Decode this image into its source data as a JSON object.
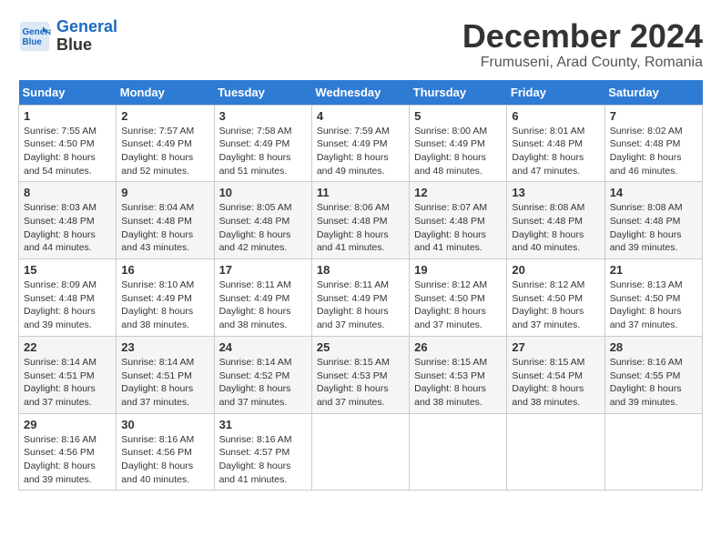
{
  "logo": {
    "line1": "General",
    "line2": "Blue"
  },
  "title": "December 2024",
  "location": "Frumuseni, Arad County, Romania",
  "days_header": [
    "Sunday",
    "Monday",
    "Tuesday",
    "Wednesday",
    "Thursday",
    "Friday",
    "Saturday"
  ],
  "weeks": [
    [
      {
        "day": "1",
        "sunrise": "7:55 AM",
        "sunset": "4:50 PM",
        "daylight": "8 hours and 54 minutes."
      },
      {
        "day": "2",
        "sunrise": "7:57 AM",
        "sunset": "4:49 PM",
        "daylight": "8 hours and 52 minutes."
      },
      {
        "day": "3",
        "sunrise": "7:58 AM",
        "sunset": "4:49 PM",
        "daylight": "8 hours and 51 minutes."
      },
      {
        "day": "4",
        "sunrise": "7:59 AM",
        "sunset": "4:49 PM",
        "daylight": "8 hours and 49 minutes."
      },
      {
        "day": "5",
        "sunrise": "8:00 AM",
        "sunset": "4:49 PM",
        "daylight": "8 hours and 48 minutes."
      },
      {
        "day": "6",
        "sunrise": "8:01 AM",
        "sunset": "4:48 PM",
        "daylight": "8 hours and 47 minutes."
      },
      {
        "day": "7",
        "sunrise": "8:02 AM",
        "sunset": "4:48 PM",
        "daylight": "8 hours and 46 minutes."
      }
    ],
    [
      {
        "day": "8",
        "sunrise": "8:03 AM",
        "sunset": "4:48 PM",
        "daylight": "8 hours and 44 minutes."
      },
      {
        "day": "9",
        "sunrise": "8:04 AM",
        "sunset": "4:48 PM",
        "daylight": "8 hours and 43 minutes."
      },
      {
        "day": "10",
        "sunrise": "8:05 AM",
        "sunset": "4:48 PM",
        "daylight": "8 hours and 42 minutes."
      },
      {
        "day": "11",
        "sunrise": "8:06 AM",
        "sunset": "4:48 PM",
        "daylight": "8 hours and 41 minutes."
      },
      {
        "day": "12",
        "sunrise": "8:07 AM",
        "sunset": "4:48 PM",
        "daylight": "8 hours and 41 minutes."
      },
      {
        "day": "13",
        "sunrise": "8:08 AM",
        "sunset": "4:48 PM",
        "daylight": "8 hours and 40 minutes."
      },
      {
        "day": "14",
        "sunrise": "8:08 AM",
        "sunset": "4:48 PM",
        "daylight": "8 hours and 39 minutes."
      }
    ],
    [
      {
        "day": "15",
        "sunrise": "8:09 AM",
        "sunset": "4:48 PM",
        "daylight": "8 hours and 39 minutes."
      },
      {
        "day": "16",
        "sunrise": "8:10 AM",
        "sunset": "4:49 PM",
        "daylight": "8 hours and 38 minutes."
      },
      {
        "day": "17",
        "sunrise": "8:11 AM",
        "sunset": "4:49 PM",
        "daylight": "8 hours and 38 minutes."
      },
      {
        "day": "18",
        "sunrise": "8:11 AM",
        "sunset": "4:49 PM",
        "daylight": "8 hours and 37 minutes."
      },
      {
        "day": "19",
        "sunrise": "8:12 AM",
        "sunset": "4:50 PM",
        "daylight": "8 hours and 37 minutes."
      },
      {
        "day": "20",
        "sunrise": "8:12 AM",
        "sunset": "4:50 PM",
        "daylight": "8 hours and 37 minutes."
      },
      {
        "day": "21",
        "sunrise": "8:13 AM",
        "sunset": "4:50 PM",
        "daylight": "8 hours and 37 minutes."
      }
    ],
    [
      {
        "day": "22",
        "sunrise": "8:14 AM",
        "sunset": "4:51 PM",
        "daylight": "8 hours and 37 minutes."
      },
      {
        "day": "23",
        "sunrise": "8:14 AM",
        "sunset": "4:51 PM",
        "daylight": "8 hours and 37 minutes."
      },
      {
        "day": "24",
        "sunrise": "8:14 AM",
        "sunset": "4:52 PM",
        "daylight": "8 hours and 37 minutes."
      },
      {
        "day": "25",
        "sunrise": "8:15 AM",
        "sunset": "4:53 PM",
        "daylight": "8 hours and 37 minutes."
      },
      {
        "day": "26",
        "sunrise": "8:15 AM",
        "sunset": "4:53 PM",
        "daylight": "8 hours and 38 minutes."
      },
      {
        "day": "27",
        "sunrise": "8:15 AM",
        "sunset": "4:54 PM",
        "daylight": "8 hours and 38 minutes."
      },
      {
        "day": "28",
        "sunrise": "8:16 AM",
        "sunset": "4:55 PM",
        "daylight": "8 hours and 39 minutes."
      }
    ],
    [
      {
        "day": "29",
        "sunrise": "8:16 AM",
        "sunset": "4:56 PM",
        "daylight": "8 hours and 39 minutes."
      },
      {
        "day": "30",
        "sunrise": "8:16 AM",
        "sunset": "4:56 PM",
        "daylight": "8 hours and 40 minutes."
      },
      {
        "day": "31",
        "sunrise": "8:16 AM",
        "sunset": "4:57 PM",
        "daylight": "8 hours and 41 minutes."
      },
      null,
      null,
      null,
      null
    ]
  ]
}
